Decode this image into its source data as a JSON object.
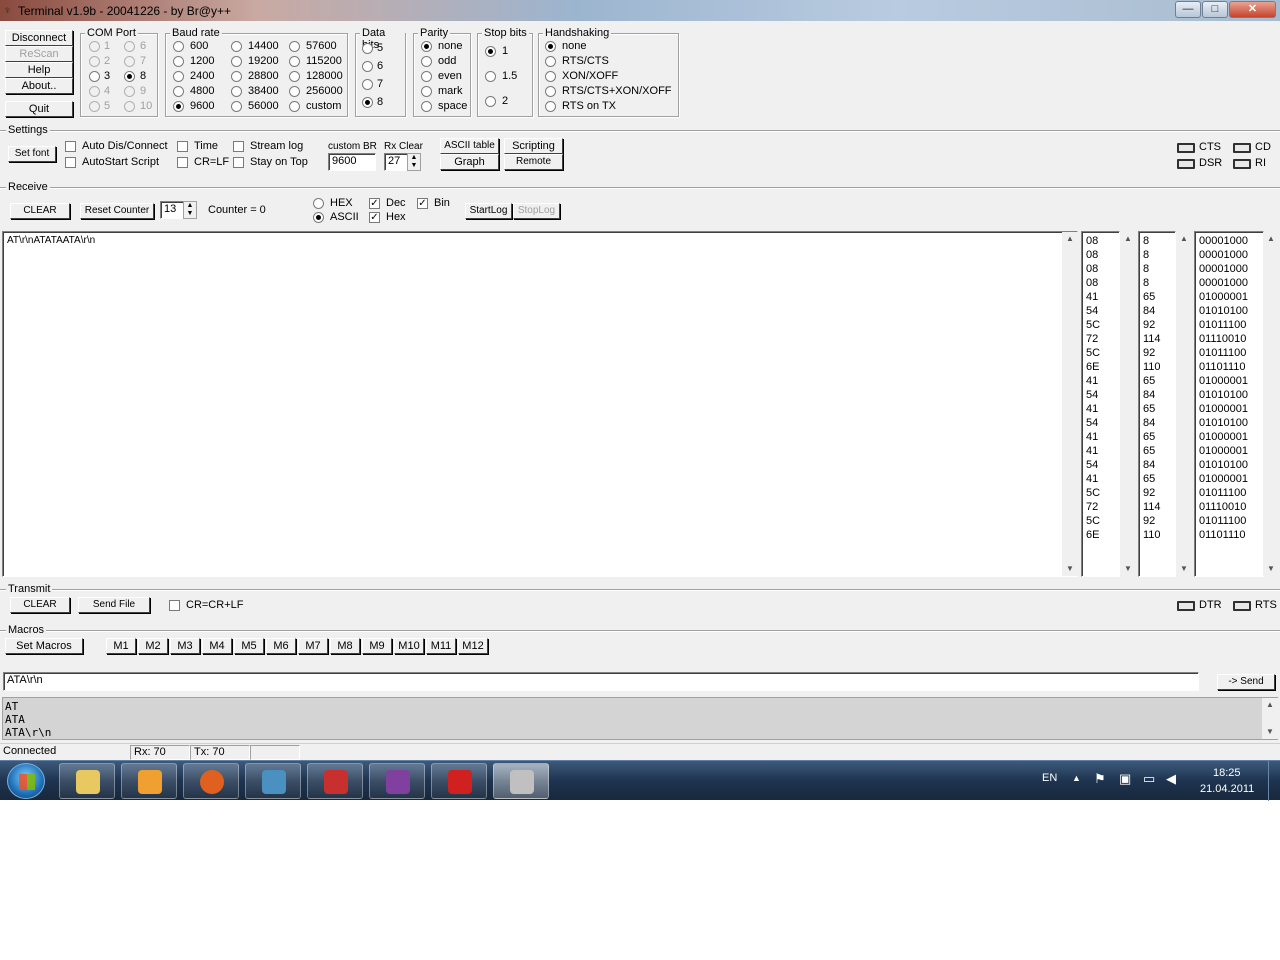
{
  "title": "Terminal v1.9b - 20041226 - by Br@y++",
  "window_buttons": {
    "minimize": "—",
    "maximize": "□",
    "close": "✕"
  },
  "main_buttons": {
    "disconnect": "Disconnect",
    "rescan": "ReScan",
    "help": "Help",
    "about": "About..",
    "quit": "Quit"
  },
  "com_port": {
    "label": "COM Port",
    "options": [
      "1",
      "2",
      "3",
      "4",
      "5",
      "6",
      "7",
      "8",
      "9",
      "10"
    ],
    "selected": "8"
  },
  "baud_rate": {
    "label": "Baud rate",
    "options": [
      "600",
      "1200",
      "2400",
      "4800",
      "9600",
      "14400",
      "19200",
      "28800",
      "38400",
      "56000",
      "57600",
      "115200",
      "128000",
      "256000",
      "custom"
    ],
    "selected": "9600"
  },
  "data_bits": {
    "label": "Data bits",
    "options": [
      "5",
      "6",
      "7",
      "8"
    ],
    "selected": "8"
  },
  "parity": {
    "label": "Parity",
    "options": [
      "none",
      "odd",
      "even",
      "mark",
      "space"
    ],
    "selected": "none"
  },
  "stop_bits": {
    "label": "Stop bits",
    "options": [
      "1",
      "1.5",
      "2"
    ],
    "selected": "1"
  },
  "handshaking": {
    "label": "Handshaking",
    "options": [
      "none",
      "RTS/CTS",
      "XON/XOFF",
      "RTS/CTS+XON/XOFF",
      "RTS on TX"
    ],
    "selected": "none"
  },
  "settings": {
    "label": "Settings",
    "set_font": "Set font",
    "auto_dis_connect": "Auto Dis/Connect",
    "autostart_script": "AutoStart Script",
    "time": "Time",
    "cr_lf": "CR=LF",
    "stream_log": "Stream log",
    "stay_on_top": "Stay on Top",
    "custom_br_label": "custom BR",
    "custom_br_value": "9600",
    "rx_clear_label": "Rx Clear",
    "rx_clear_value": "27",
    "ascii_table": "ASCII table",
    "graph": "Graph",
    "scripting": "Scripting",
    "remote": "Remote",
    "leds": {
      "cts": "CTS",
      "cd": "CD",
      "dsr": "DSR",
      "ri": "RI"
    }
  },
  "receive": {
    "label": "Receive",
    "clear": "CLEAR",
    "reset_counter": "Reset Counter",
    "counter_spin": "13",
    "counter_text": "Counter = 0",
    "hex": "HEX",
    "ascii": "ASCII",
    "mode_selected": "ASCII",
    "dec": "Dec",
    "hex_check": "Hex",
    "bin": "Bin",
    "dec_checked": true,
    "hex_checked": true,
    "bin_checked": true,
    "startlog": "StartLog",
    "stoplog": "StopLog",
    "text": "AT\\r\\nATATAATA\\r\\n",
    "hex_values": [
      "08",
      "08",
      "08",
      "08",
      "41",
      "54",
      "5C",
      "72",
      "5C",
      "6E",
      "41",
      "54",
      "41",
      "54",
      "41",
      "41",
      "54",
      "41",
      "5C",
      "72",
      "5C",
      "6E"
    ],
    "dec_values": [
      "8",
      "8",
      "8",
      "8",
      "65",
      "84",
      "92",
      "114",
      "92",
      "110",
      "65",
      "84",
      "65",
      "84",
      "65",
      "65",
      "84",
      "65",
      "92",
      "114",
      "92",
      "110"
    ],
    "bin_values": [
      "00001000",
      "00001000",
      "00001000",
      "00001000",
      "01000001",
      "01010100",
      "01011100",
      "01110010",
      "01011100",
      "01101110",
      "01000001",
      "01010100",
      "01000001",
      "01010100",
      "01000001",
      "01000001",
      "01010100",
      "01000001",
      "01011100",
      "01110010",
      "01011100",
      "01101110"
    ]
  },
  "transmit": {
    "label": "Transmit",
    "clear": "CLEAR",
    "send_file": "Send File",
    "cr_crlf": "CR=CR+LF",
    "leds": {
      "dtr": "DTR",
      "rts": "RTS"
    }
  },
  "macros": {
    "label": "Macros",
    "set_macros": "Set Macros",
    "items": [
      "M1",
      "M2",
      "M3",
      "M4",
      "M5",
      "M6",
      "M7",
      "M8",
      "M9",
      "M10",
      "M11",
      "M12"
    ]
  },
  "send": {
    "input_value": "ATA\\r\\n",
    "button": "-> Send"
  },
  "history": [
    "AT",
    "ATA",
    "ATA\\r\\n"
  ],
  "status": {
    "connected": "Connected",
    "rx": "Rx: 70",
    "tx": "Tx: 70"
  },
  "taskbar": {
    "lang": "EN",
    "time": "18:25",
    "date": "21.04.2011",
    "colors": {
      "start": "#2a8ad4",
      "explorer": "#e8c860",
      "media": "#f0a030",
      "firefox": "#e06020",
      "control": "#4a90c0",
      "toolbox": "#c83030",
      "winrar": "#8040a0",
      "acrobat": "#d02020",
      "terminal": "#c0c0c0"
    }
  }
}
